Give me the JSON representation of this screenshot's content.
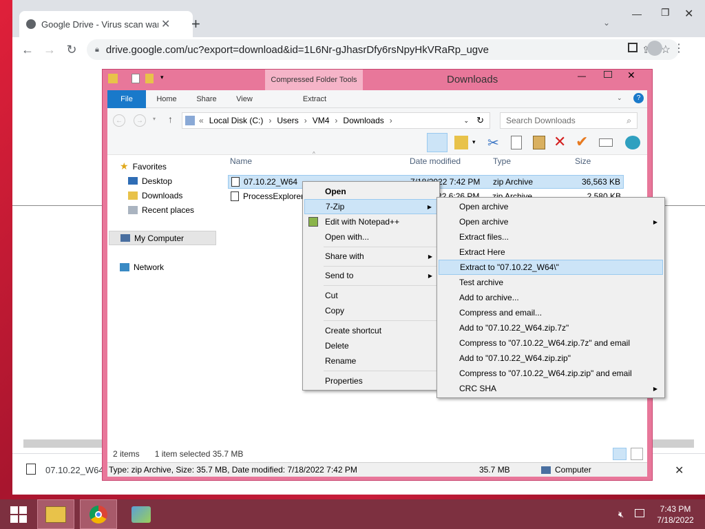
{
  "browser": {
    "tab_title": "Google Drive - Virus scan warnin",
    "new_tab": "+",
    "url": "drive.google.com/uc?export=download&id=1L6Nr-gJhasrDfy6rsNpyHkVRaRp_ugve"
  },
  "download_shelf": {
    "filename": "07.10.22_W64"
  },
  "explorer": {
    "title": "Downloads",
    "context_tab": "Compressed Folder Tools",
    "tabs": [
      "File",
      "Home",
      "Share",
      "View",
      "Extract"
    ],
    "breadcrumb": [
      "Local Disk (C:)",
      "Users",
      "VM4",
      "Downloads"
    ],
    "search_placeholder": "Search Downloads",
    "nav": {
      "favorites": "Favorites",
      "desktop": "Desktop",
      "downloads": "Downloads",
      "recent": "Recent places",
      "computer": "My Computer",
      "network": "Network"
    },
    "columns": [
      "Name",
      "Date modified",
      "Type",
      "Size"
    ],
    "files": [
      {
        "name": "07.10.22_W64",
        "date": "7/18/2022 7:42 PM",
        "type": "zip Archive",
        "size": "36,563 KB"
      },
      {
        "name": "ProcessExplorer",
        "date": "7/18/2022 6:26 PM",
        "type": "zip Archive",
        "size": "2,580 KB"
      }
    ],
    "status": {
      "items": "2 items",
      "selected": "1 item selected  35.7 MB"
    },
    "details": {
      "info": "Type: zip Archive, Size: 35.7 MB, Date modified: 7/18/2022 7:42 PM",
      "size": "35.7 MB",
      "location": "Computer"
    }
  },
  "context_menu": {
    "open": "Open",
    "zip": "7-Zip",
    "notepad": "Edit with Notepad++",
    "open_with": "Open with...",
    "share_with": "Share with",
    "send_to": "Send to",
    "cut": "Cut",
    "copy": "Copy",
    "create_shortcut": "Create shortcut",
    "delete": "Delete",
    "rename": "Rename",
    "properties": "Properties"
  },
  "submenu": [
    "Open archive",
    "Open archive",
    "Extract files...",
    "Extract Here",
    "Extract to \"07.10.22_W64\\\"",
    "Test archive",
    "Add to archive...",
    "Compress and email...",
    "Add to \"07.10.22_W64.zip.7z\"",
    "Compress to \"07.10.22_W64.zip.7z\" and email",
    "Add to \"07.10.22_W64.zip.zip\"",
    "Compress to \"07.10.22_W64.zip.zip\" and email",
    "CRC SHA"
  ],
  "taskbar": {
    "time": "7:43 PM",
    "date": "7/18/2022"
  },
  "colors": {
    "explorer_frame": "#e8779a",
    "highlight": "#cce4f7",
    "file_tab": "#1979ca"
  }
}
